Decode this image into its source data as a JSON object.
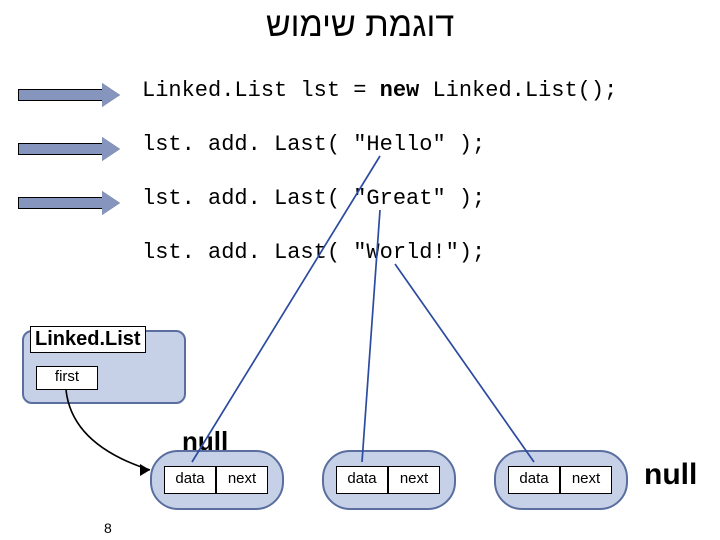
{
  "title": "דוגמת שימוש",
  "code": {
    "l1_a": "Linked.List lst = ",
    "l1_b": "new",
    "l1_c": " Linked.List();",
    "l2": "lst. add. Last( \"Hello\" );",
    "l3": "lst. add. Last( \"Great\" );",
    "l4": "lst. add. Last( \"World!\");"
  },
  "linkedlist_label": "Linked.List",
  "first_label": "first",
  "node_labels": {
    "data": "data",
    "next": "next"
  },
  "null_label": "null",
  "end_null": "null",
  "page_number": "8"
}
